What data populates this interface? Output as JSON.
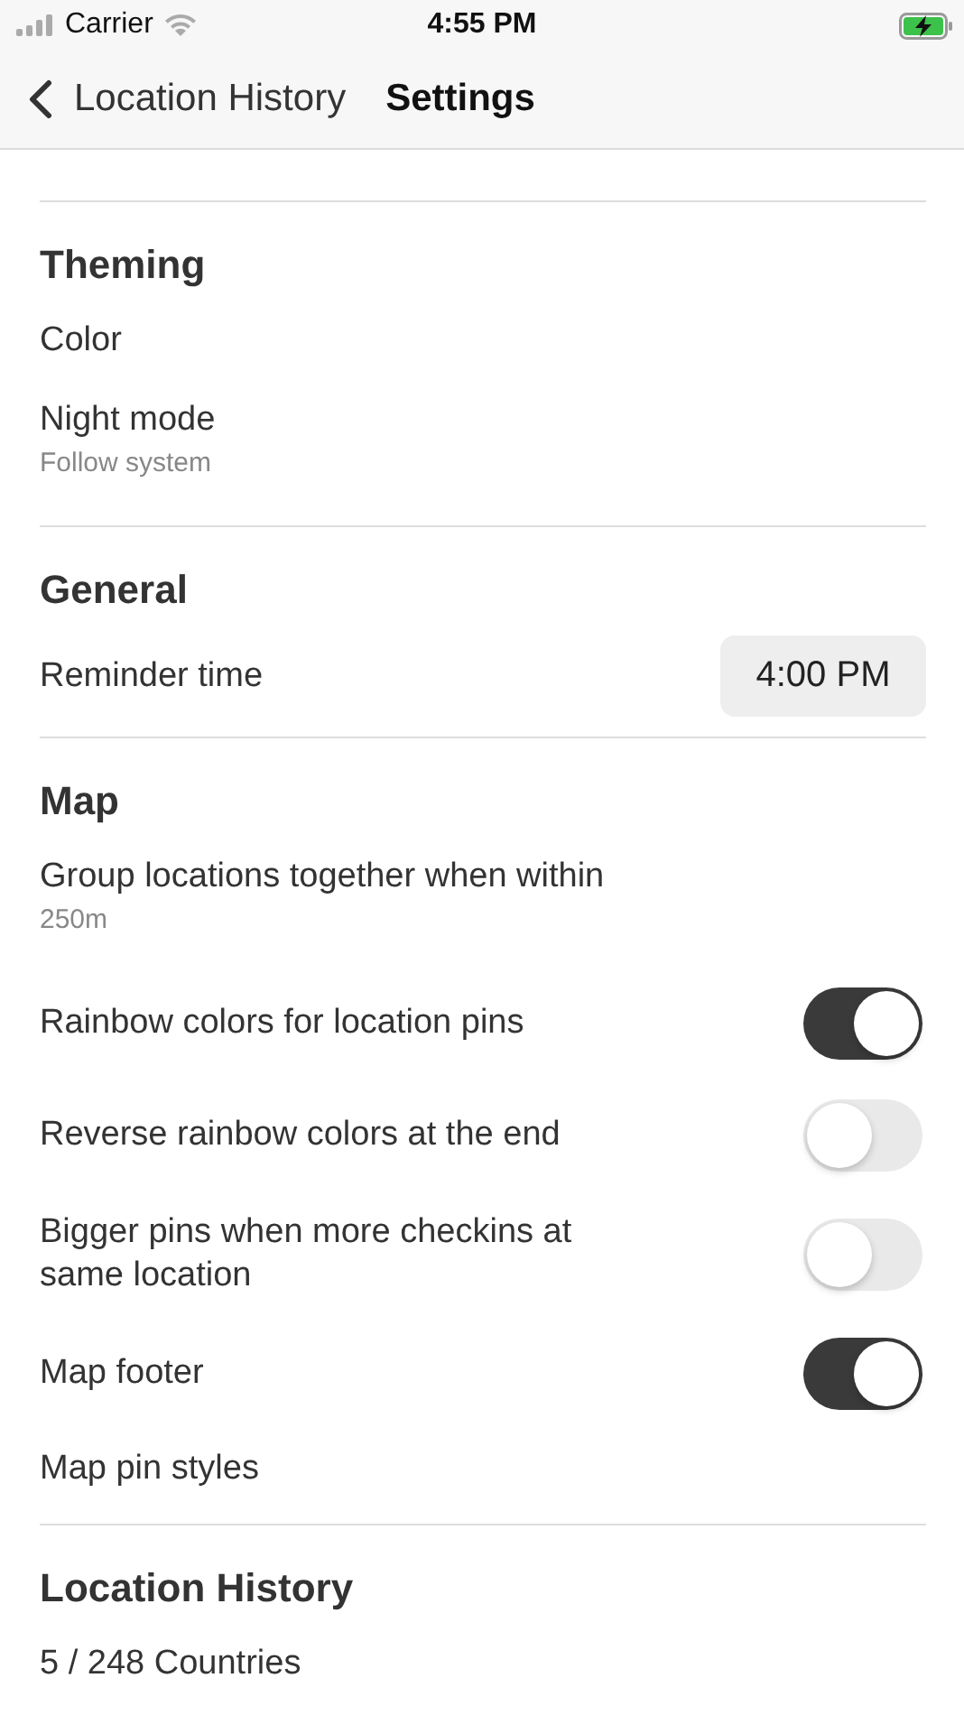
{
  "status_bar": {
    "carrier": "Carrier",
    "time": "4:55 PM"
  },
  "nav": {
    "back": "Location History",
    "title": "Settings"
  },
  "sections": [
    {
      "title": "Theming",
      "items": [
        {
          "kind": "plain",
          "label": "Color"
        },
        {
          "kind": "subtitle",
          "label": "Night mode",
          "subtitle": "Follow system"
        }
      ]
    },
    {
      "title": "General",
      "items": [
        {
          "kind": "time",
          "label": "Reminder time",
          "value": "4:00 PM"
        }
      ]
    },
    {
      "title": "Map",
      "items": [
        {
          "kind": "subtitle",
          "label": "Group locations together when within",
          "subtitle": "250m"
        },
        {
          "kind": "toggle",
          "label": "Rainbow colors for location pins",
          "on": true
        },
        {
          "kind": "toggle",
          "label": "Reverse rainbow colors at the end",
          "on": false
        },
        {
          "kind": "toggle",
          "label": "Bigger pins when more checkins at same location",
          "on": false
        },
        {
          "kind": "toggle",
          "label": "Map footer",
          "on": true
        },
        {
          "kind": "plain",
          "label": "Map pin styles"
        }
      ]
    },
    {
      "title": "Location History",
      "items": [
        {
          "kind": "plain",
          "label": "5 / 248 Countries"
        }
      ]
    }
  ]
}
